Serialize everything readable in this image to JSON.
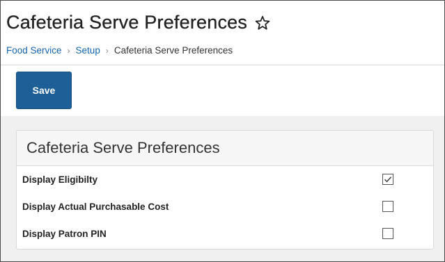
{
  "header": {
    "title": "Cafeteria Serve Preferences",
    "favorite_icon": "star-outline-icon",
    "breadcrumb": [
      {
        "label": "Food Service",
        "link": true
      },
      {
        "label": "Setup",
        "link": true
      },
      {
        "label": "Cafeteria Serve Preferences",
        "link": false
      }
    ],
    "separator": "›"
  },
  "toolbar": {
    "save_label": "Save",
    "save_color": "#1d5f96"
  },
  "panel": {
    "title": "Cafeteria Serve Preferences",
    "preferences": [
      {
        "label": "Display Eligibilty",
        "checked": true
      },
      {
        "label": "Display Actual Purchasable Cost",
        "checked": false
      },
      {
        "label": "Display Patron PIN",
        "checked": false
      }
    ]
  }
}
